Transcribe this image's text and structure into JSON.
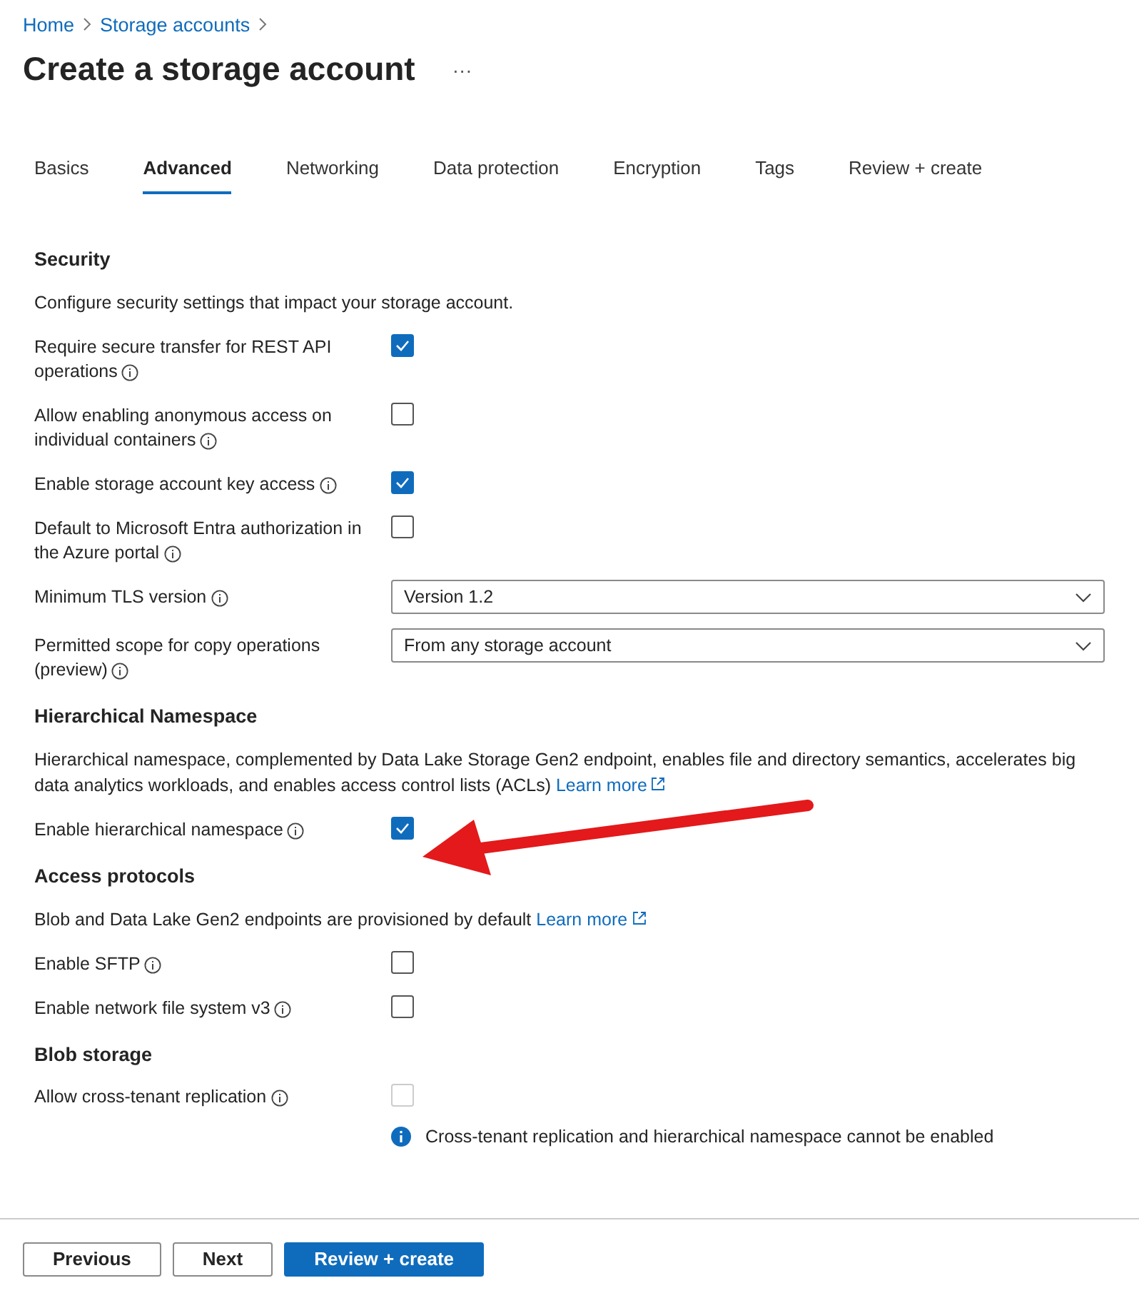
{
  "breadcrumb": [
    "Home",
    "Storage accounts"
  ],
  "title": "Create a storage account",
  "more_menu": "···",
  "tabs": [
    {
      "label": "Basics",
      "selected": false
    },
    {
      "label": "Advanced",
      "selected": true
    },
    {
      "label": "Networking",
      "selected": false
    },
    {
      "label": "Data protection",
      "selected": false
    },
    {
      "label": "Encryption",
      "selected": false
    },
    {
      "label": "Tags",
      "selected": false
    },
    {
      "label": "Review + create",
      "selected": false
    }
  ],
  "sections": [
    {
      "heading": "Security",
      "description": "Configure security settings that impact your storage account.",
      "rows": [
        {
          "kind": "checkbox",
          "label_lines": [
            "Require secure transfer for REST API",
            "operations"
          ],
          "checked": true,
          "disabled": false
        },
        {
          "kind": "checkbox",
          "label_lines": [
            "Allow enabling anonymous access on",
            "individual containers"
          ],
          "checked": false,
          "disabled": false
        },
        {
          "kind": "checkbox",
          "label_lines": [
            "Enable storage account key access"
          ],
          "checked": true,
          "disabled": false
        },
        {
          "kind": "checkbox",
          "label_lines": [
            "Default to Microsoft Entra authorization in",
            "the Azure portal"
          ],
          "checked": false,
          "disabled": false
        },
        {
          "kind": "dropdown",
          "label_lines": [
            "Minimum TLS version"
          ],
          "value": "Version 1.2"
        },
        {
          "kind": "dropdown",
          "label_lines": [
            "Permitted scope for copy operations",
            "(preview)"
          ],
          "value": "From any storage account"
        }
      ]
    },
    {
      "heading": "Hierarchical Namespace",
      "description": "Hierarchical namespace, complemented by Data Lake Storage Gen2 endpoint, enables file and directory semantics, accelerates big data analytics workloads, and enables access control lists (ACLs)",
      "link": "Learn more",
      "rows": [
        {
          "kind": "checkbox",
          "label_lines": [
            "Enable hierarchical namespace"
          ],
          "checked": true,
          "disabled": false
        }
      ]
    },
    {
      "heading": "Access protocols",
      "description": "Blob and Data Lake Gen2 endpoints are provisioned by default",
      "link": "Learn more",
      "rows": [
        {
          "kind": "checkbox",
          "label_lines": [
            "Enable SFTP"
          ],
          "checked": false,
          "disabled": false
        },
        {
          "kind": "checkbox",
          "label_lines": [
            "Enable network file system v3"
          ],
          "checked": false,
          "disabled": false
        }
      ]
    },
    {
      "heading": "Blob storage",
      "rows": [
        {
          "kind": "checkbox",
          "label_lines": [
            "Allow cross-tenant replication"
          ],
          "checked": false,
          "disabled": true,
          "note": "Cross-tenant replication and hierarchical namespace cannot be enabled"
        }
      ]
    }
  ],
  "footer": {
    "buttons": [
      {
        "label": "Previous",
        "kind": "secondary"
      },
      {
        "label": "Next",
        "kind": "secondary"
      },
      {
        "label": "Review + create",
        "kind": "primary"
      }
    ]
  }
}
